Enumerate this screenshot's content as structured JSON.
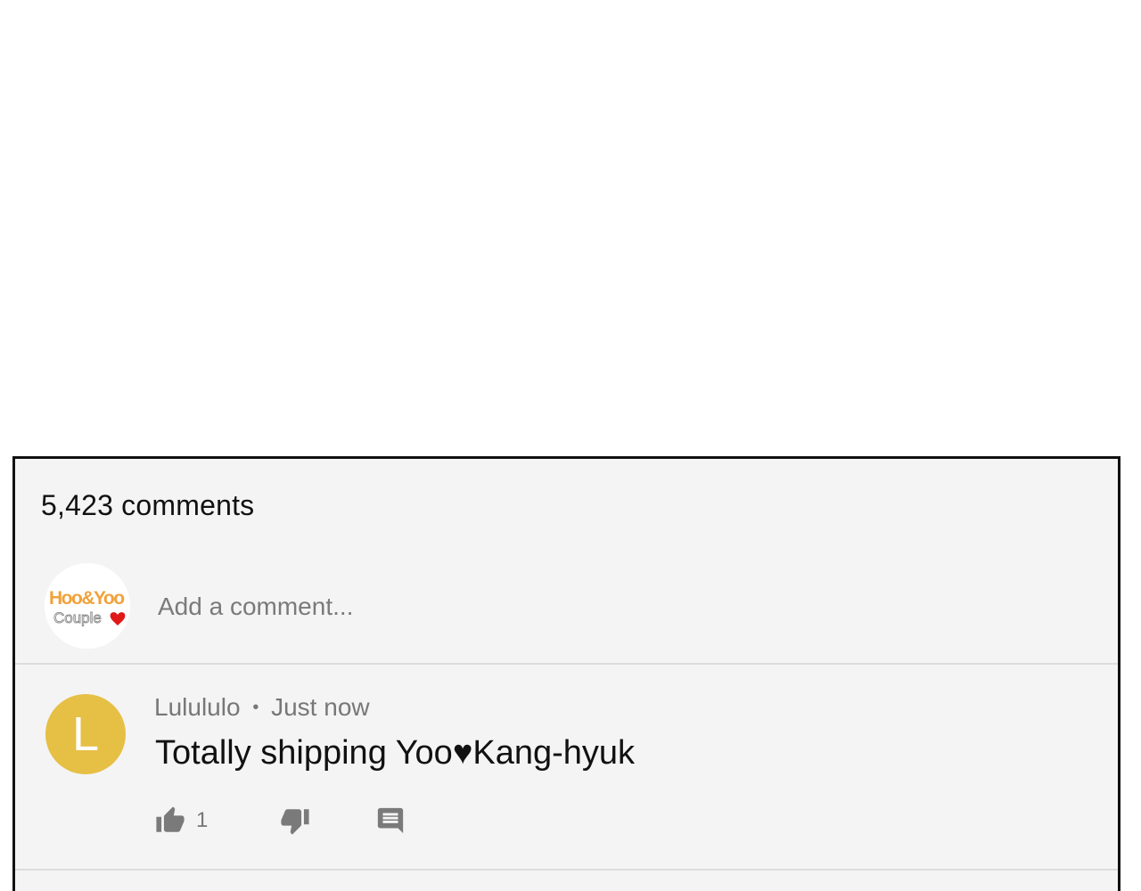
{
  "comments_header": {
    "count_label": "5,423 comments"
  },
  "composer": {
    "avatar_logo_top": "Hoo&Yoo",
    "avatar_logo_bottom": "Couple",
    "placeholder": "Add a comment..."
  },
  "comments": [
    {
      "avatar_letter": "L",
      "avatar_color": "#e6bf45",
      "author": "Lulululo",
      "separator": "•",
      "time": "Just now",
      "text": "Totally shipping Yoo♥Kang-hyuk",
      "likes": "1",
      "icons": {
        "like": "thumbs-up-icon",
        "dislike": "thumbs-down-icon",
        "reply": "reply-comment-icon"
      }
    }
  ],
  "colors": {
    "panel_background": "#f4f4f4",
    "panel_border": "#111111",
    "muted_text": "#777777",
    "icon_gray": "#7a7a7a",
    "logo_orange": "#f0a23a",
    "logo_heart": "#e01818"
  }
}
